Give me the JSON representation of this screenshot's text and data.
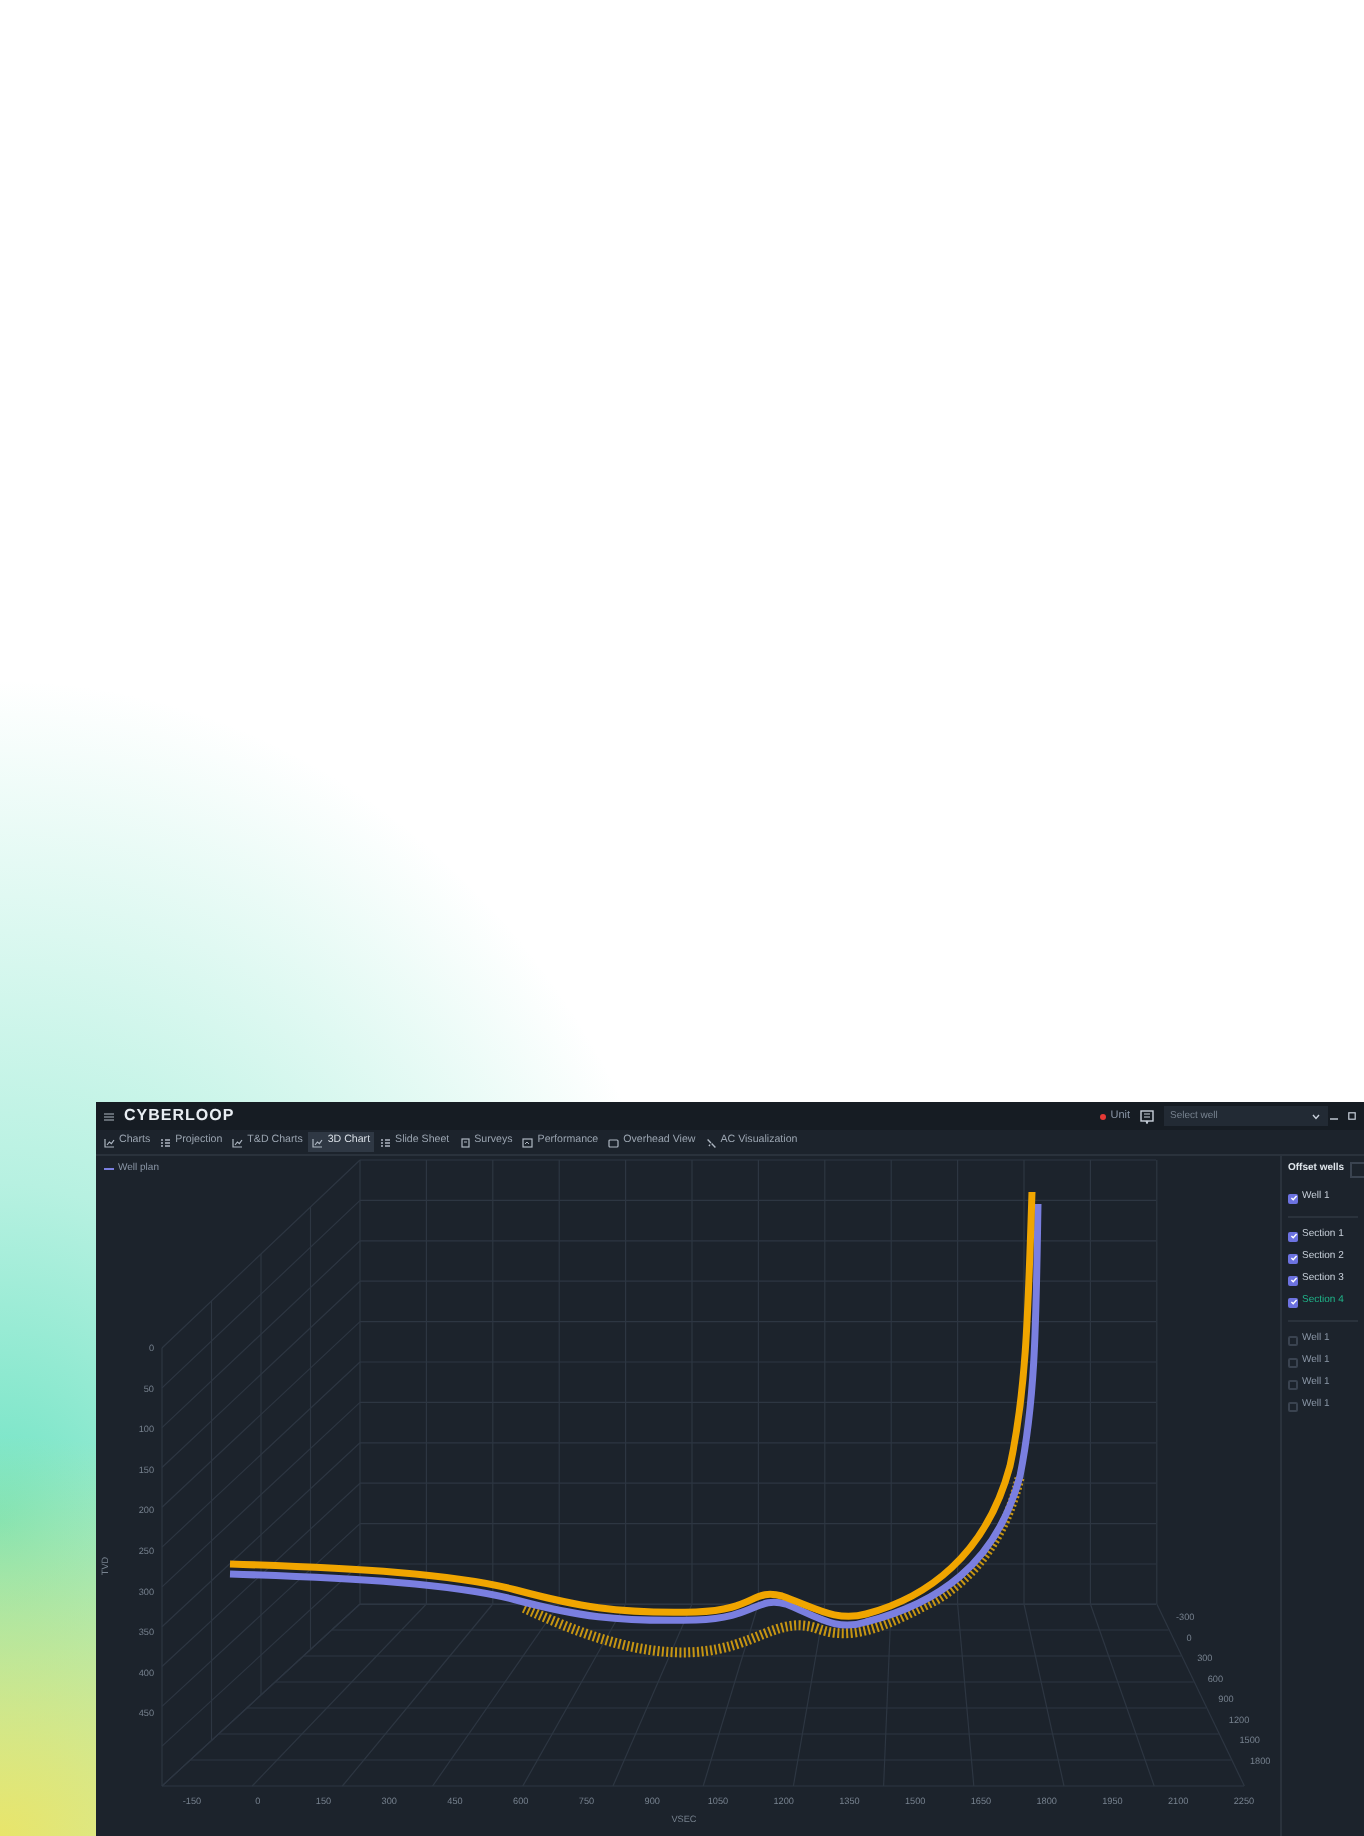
{
  "app": {
    "logo": "CYBERLOOP",
    "status": {
      "label": "Unit",
      "on": true
    },
    "well_select": {
      "placeholder": "Select well"
    }
  },
  "tabs": [
    {
      "label": "Charts",
      "kind": "line",
      "selected": false
    },
    {
      "label": "Projection",
      "kind": "grid",
      "selected": false
    },
    {
      "label": "T&D Charts",
      "kind": "line",
      "selected": false
    },
    {
      "label": "3D Chart",
      "kind": "line",
      "selected": true
    },
    {
      "label": "Slide Sheet",
      "kind": "grid",
      "selected": false
    },
    {
      "label": "Surveys",
      "kind": "doc",
      "selected": false
    },
    {
      "label": "Performance",
      "kind": "screen",
      "selected": false
    },
    {
      "label": "Overhead View",
      "kind": "square",
      "selected": false
    },
    {
      "label": "AC Visualization",
      "kind": "tool",
      "selected": false
    }
  ],
  "chart": {
    "legend": "Well plan",
    "y_title": "TVD",
    "x_title": "VSEC",
    "y_ticks": [
      "0",
      "50",
      "100",
      "150",
      "200",
      "250",
      "300",
      "350",
      "400",
      "450"
    ],
    "x_ticks": [
      "-150",
      "0",
      "150",
      "300",
      "450",
      "600",
      "750",
      "900",
      "1050",
      "1200",
      "1350",
      "1500",
      "1650",
      "1800",
      "1950",
      "2100",
      "2250"
    ],
    "z_ticks": [
      "-300",
      "0",
      "300",
      "600",
      "900",
      "1200",
      "1500",
      "1800"
    ]
  },
  "offset_wells": {
    "title": "Offset wells",
    "groups": [
      [
        {
          "label": "Well 1",
          "checked": true,
          "selected": false
        }
      ],
      [
        {
          "label": "Section 1",
          "checked": true,
          "selected": false
        },
        {
          "label": "Section 2",
          "checked": true,
          "selected": false
        },
        {
          "label": "Section 3",
          "checked": true,
          "selected": false
        },
        {
          "label": "Section 4",
          "checked": true,
          "selected": true
        }
      ],
      [
        {
          "label": "Well 1",
          "checked": false,
          "selected": false
        },
        {
          "label": "Well 1",
          "checked": false,
          "selected": false
        },
        {
          "label": "Well 1",
          "checked": false,
          "selected": false
        },
        {
          "label": "Well 1",
          "checked": false,
          "selected": false
        }
      ]
    ]
  }
}
